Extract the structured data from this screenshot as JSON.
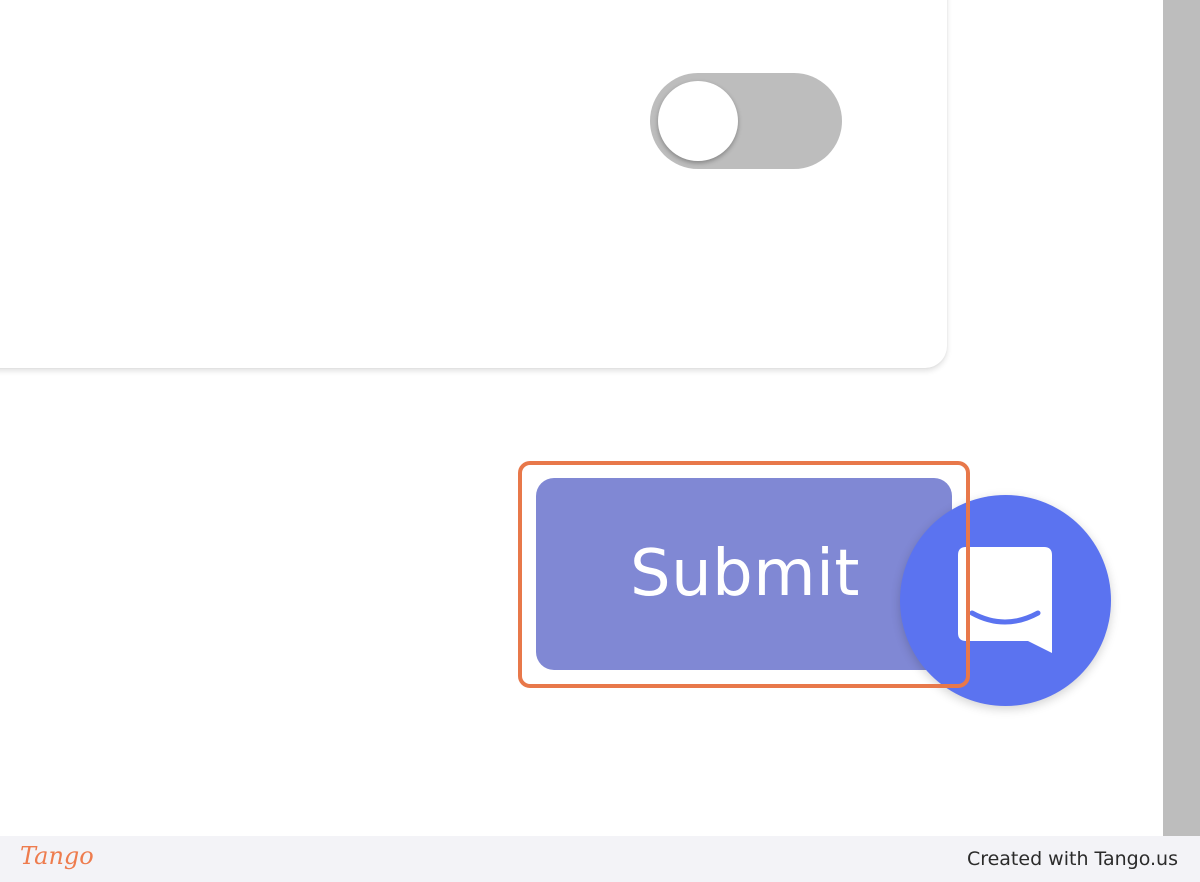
{
  "form": {
    "toggle_state": "off",
    "submit_label": "Submit"
  },
  "chat_widget": {
    "icon": "chat-bubble-icon",
    "color": "#5b73f0"
  },
  "highlight": {
    "color": "#e8784a"
  },
  "footer": {
    "logo_text": "Tango",
    "credit_text": "Created with Tango.us"
  },
  "colors": {
    "submit_button": "#8088d4",
    "toggle_track": "#bdbdbd",
    "brand_accent": "#ee7c4e"
  }
}
